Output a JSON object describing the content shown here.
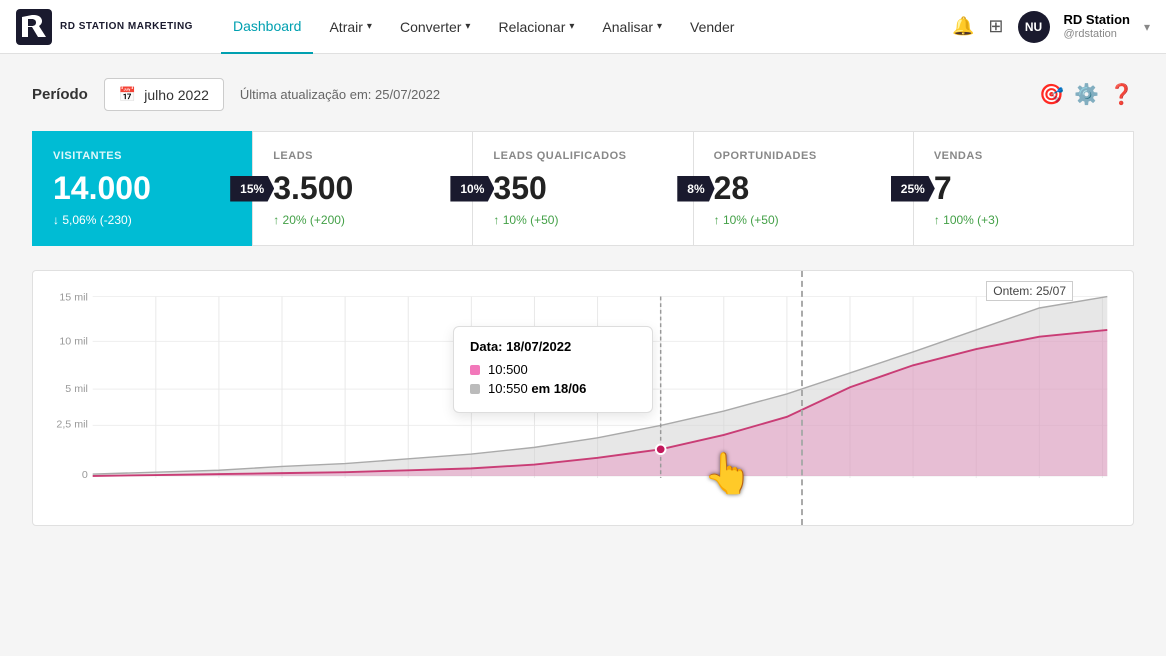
{
  "app": {
    "title": "RD Station Marketing",
    "logo_text": "RD STATION MARKETING"
  },
  "navbar": {
    "items": [
      {
        "id": "dashboard",
        "label": "Dashboard",
        "active": true,
        "has_dropdown": false
      },
      {
        "id": "atrair",
        "label": "Atrair",
        "active": false,
        "has_dropdown": true
      },
      {
        "id": "converter",
        "label": "Converter",
        "active": false,
        "has_dropdown": true
      },
      {
        "id": "relacionar",
        "label": "Relacionar",
        "active": false,
        "has_dropdown": true
      },
      {
        "id": "analisar",
        "label": "Analisar",
        "active": false,
        "has_dropdown": true
      },
      {
        "id": "vender",
        "label": "Vender",
        "active": false,
        "has_dropdown": false
      }
    ],
    "user": {
      "initials": "NU",
      "name": "RD Station",
      "handle": "@rdstation"
    }
  },
  "period": {
    "label": "Período",
    "value": "julho 2022",
    "last_update": "Última atualização em: 25/07/2022"
  },
  "metrics": [
    {
      "id": "visitantes",
      "title": "VISITANTES",
      "value": "14.000",
      "change": "↓ 5,06% (-230)",
      "change_type": "down",
      "badge": "15%",
      "teal": true
    },
    {
      "id": "leads",
      "title": "LEADS",
      "value": "3.500",
      "change": "↑ 20% (+200)",
      "change_type": "up",
      "badge": "10%",
      "teal": false
    },
    {
      "id": "leads-qualificados",
      "title": "LEADS QUALIFICADOS",
      "value": "350",
      "change": "↑ 10% (+50)",
      "change_type": "up",
      "badge": "8%",
      "teal": false
    },
    {
      "id": "oportunidades",
      "title": "OPORTUNIDADES",
      "value": "28",
      "change": "↑ 10% (+50)",
      "change_type": "up",
      "badge": "25%",
      "teal": false
    },
    {
      "id": "vendas",
      "title": "VENDAS",
      "value": "7",
      "change": "↑ 100% (+3)",
      "change_type": "up",
      "badge": null,
      "teal": false
    }
  ],
  "chart": {
    "y_labels": [
      "15 mil",
      "10 mil",
      "5 mil",
      "2,5 mil",
      "0"
    ],
    "yesterday_label": "Ontem: 25/07",
    "tooltip": {
      "date_label": "Data:",
      "date_value": "18/07/2022",
      "rows": [
        {
          "color": "pink",
          "value": "10:500"
        },
        {
          "color": "gray",
          "value": "10:550",
          "suffix": " em 18/06"
        }
      ]
    }
  }
}
